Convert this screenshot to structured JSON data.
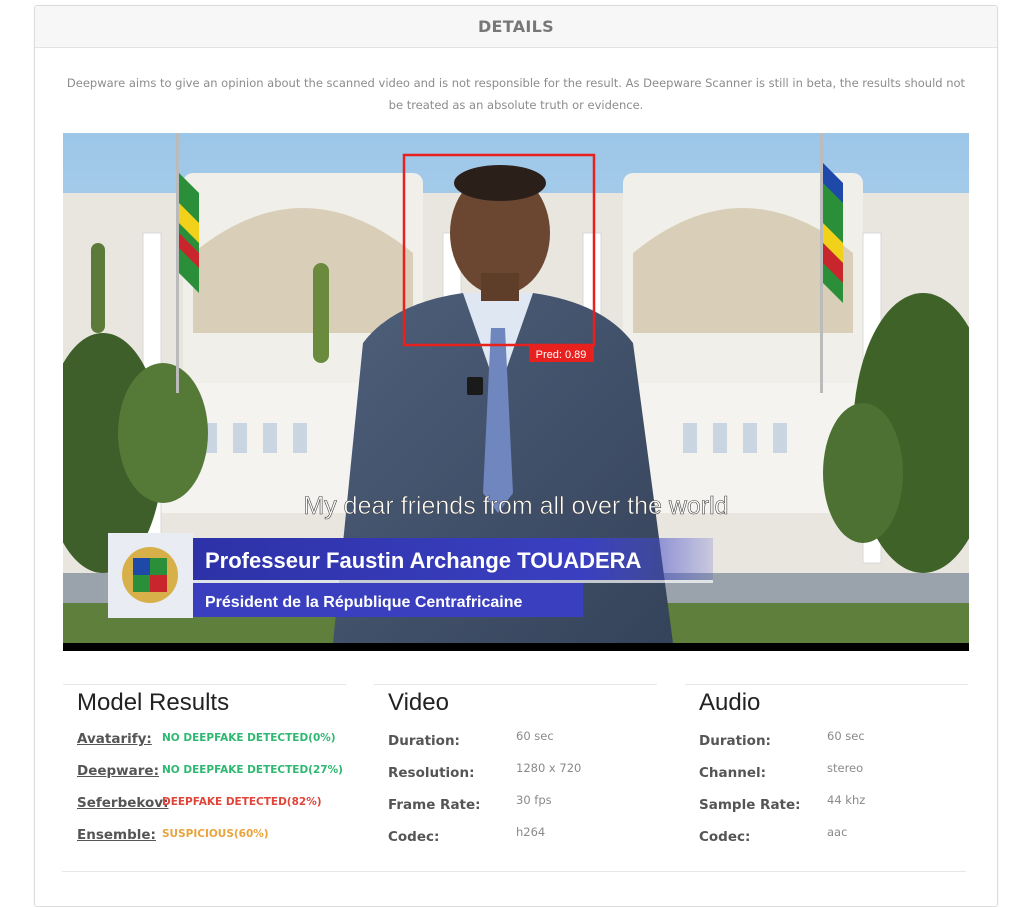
{
  "header": {
    "title": "DETAILS"
  },
  "disclaimer": "Deepware aims to give an opinion about the scanned video and is not responsible for the result. As Deepware Scanner is still in beta, the results should not be treated as an absolute truth or evidence.",
  "video": {
    "prediction_label": "Pred: 0.89",
    "subtitle": "My dear friends from all over the world",
    "lower_third": {
      "name": "Professeur Faustin Archange TOUADERA",
      "title": "Président de la République Centrafricaine"
    }
  },
  "model_results": {
    "heading": "Model Results",
    "items": [
      {
        "model": "Avatarify:",
        "result": "NO DEEPFAKE DETECTED(0%)",
        "color": "#2eb872"
      },
      {
        "model": "Deepware:",
        "result": "NO DEEPFAKE DETECTED(27%)",
        "color": "#2eb872"
      },
      {
        "model": "Seferbekov:",
        "result": "DEEPFAKE DETECTED(82%)",
        "color": "#e0453a"
      },
      {
        "model": "Ensemble:",
        "result": "SUSPICIOUS(60%)",
        "color": "#e8a33d"
      }
    ]
  },
  "video_info": {
    "heading": "Video",
    "items": [
      {
        "label": "Duration:",
        "value": "60 sec"
      },
      {
        "label": "Resolution:",
        "value": "1280 x 720"
      },
      {
        "label": "Frame Rate:",
        "value": "30 fps"
      },
      {
        "label": "Codec:",
        "value": "h264"
      }
    ]
  },
  "audio_info": {
    "heading": "Audio",
    "items": [
      {
        "label": "Duration:",
        "value": "60 sec"
      },
      {
        "label": "Channel:",
        "value": "stereo"
      },
      {
        "label": "Sample Rate:",
        "value": "44 khz"
      },
      {
        "label": "Codec:",
        "value": "aac"
      }
    ]
  }
}
